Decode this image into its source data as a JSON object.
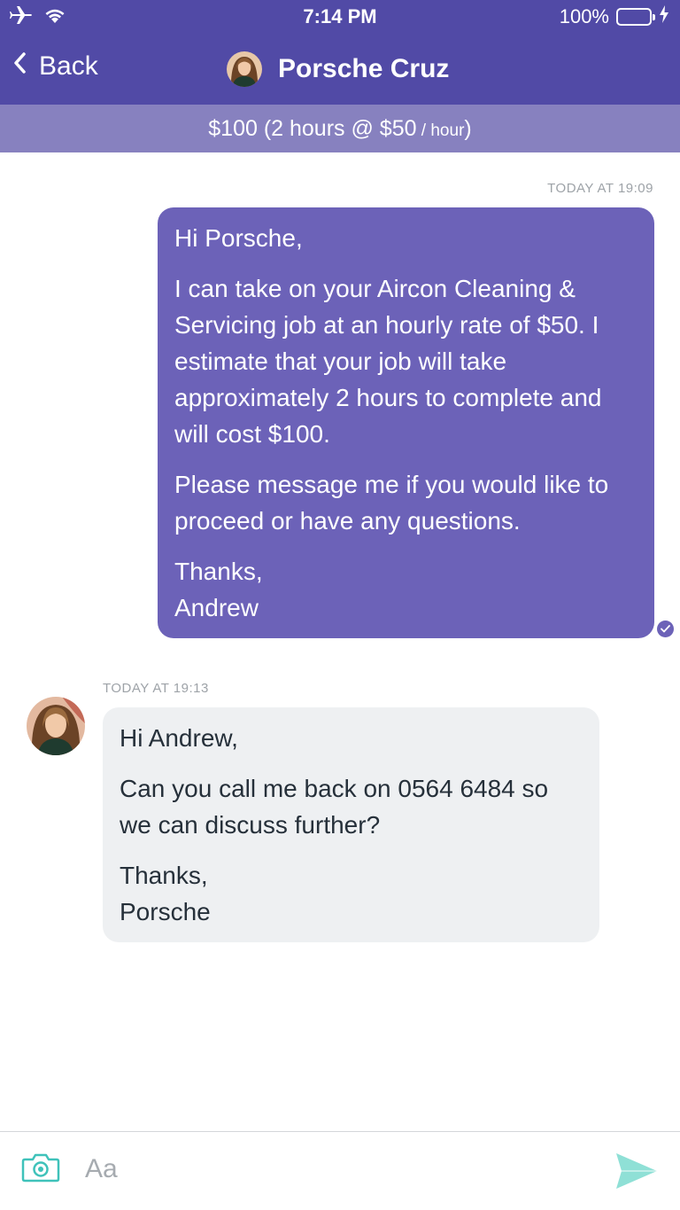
{
  "status_bar": {
    "time": "7:14 PM",
    "battery_text": "100%",
    "battery_level": 1.0,
    "icons": [
      "airplane-icon",
      "wifi-icon",
      "battery-icon",
      "charging-bolt-icon"
    ]
  },
  "nav": {
    "back_label": "Back",
    "contact_name": "Porsche Cruz"
  },
  "price_bar": {
    "main": "$100 (2 hours @ $50",
    "unit": " / hour",
    "close": ")"
  },
  "messages": [
    {
      "direction": "outgoing",
      "timestamp": "TODAY AT 19:09",
      "paragraphs": [
        "Hi Porsche,",
        "I can take on your Aircon Cleaning & Servicing job at an hourly rate of $50. I estimate that your job will take approximately 2 hours to complete and will cost $100.",
        "Please message me if you would like to proceed or have any questions.",
        "Thanks,\nAndrew"
      ]
    },
    {
      "direction": "incoming",
      "timestamp": "TODAY AT 19:13",
      "paragraphs": [
        "Hi Andrew,",
        "Can you call me back on 0564 6484 so we can discuss further?",
        "Thanks,\nPorsche"
      ]
    }
  ],
  "composer": {
    "placeholder": "Aa"
  },
  "colors": {
    "header": "#514aa6",
    "price_bar": "#8781bf",
    "outgoing_bubble": "#6c62b8",
    "incoming_bubble": "#eef0f2",
    "accent": "#3fc2ba",
    "send": "#8fe0d6"
  }
}
